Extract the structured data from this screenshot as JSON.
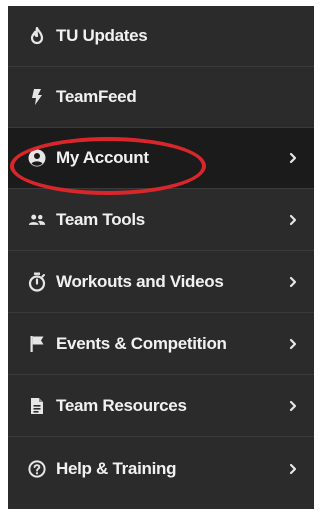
{
  "menu": {
    "items": [
      {
        "label": "TU Updates",
        "icon": "flame-icon",
        "has_submenu": false,
        "active": false
      },
      {
        "label": "TeamFeed",
        "icon": "lightning-icon",
        "has_submenu": false,
        "active": false
      },
      {
        "label": "My Account",
        "icon": "user-circle-icon",
        "has_submenu": true,
        "active": true
      },
      {
        "label": "Team Tools",
        "icon": "people-icon",
        "has_submenu": true,
        "active": false
      },
      {
        "label": "Workouts and Videos",
        "icon": "stopwatch-icon",
        "has_submenu": true,
        "active": false
      },
      {
        "label": "Events & Competition",
        "icon": "flag-icon",
        "has_submenu": true,
        "active": false
      },
      {
        "label": "Team Resources",
        "icon": "document-icon",
        "has_submenu": true,
        "active": false
      },
      {
        "label": "Help & Training",
        "icon": "help-circle-icon",
        "has_submenu": true,
        "active": false
      }
    ]
  },
  "colors": {
    "menu_background": "#2b2b2b",
    "active_background": "#1b1b1b",
    "text": "#f1f1f1",
    "highlight_ring": "#d9262b"
  }
}
